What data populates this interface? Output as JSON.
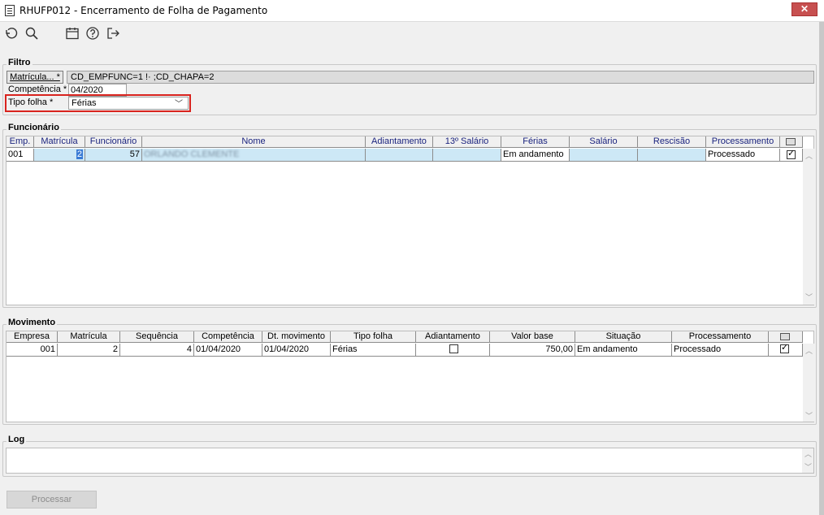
{
  "window": {
    "title": "RHUFP012 - Encerramento de Folha de Pagamento",
    "close_label": "✕"
  },
  "toolbar": {
    "icons": [
      "undo-icon",
      "search-icon",
      "calendar-icon",
      "help-icon",
      "exit-icon"
    ]
  },
  "filtro": {
    "legend": "Filtro",
    "matricula_button": "Matrícula... *",
    "matricula_value": "CD_EMPFUNC=1 !· ;CD_CHAPA=2",
    "competencia_label": "Competência *",
    "competencia_value": "04/2020",
    "tipo_folha_label": "Tipo folha *",
    "tipo_folha_value": "Férias"
  },
  "funcionario": {
    "legend": "Funcionário",
    "columns": [
      "Emp.",
      "Matrícula",
      "Funcionário",
      "Nome",
      "Adiantamento",
      "13º Salário",
      "Férias",
      "Salário",
      "Rescisão",
      "Processamento"
    ],
    "rows": [
      {
        "emp": "001",
        "matricula": "2",
        "funcionario": "57",
        "nome": "ORLANDO CLEMENTE",
        "adiantamento": "",
        "decimo": "",
        "ferias": "Em andamento",
        "salario": "",
        "rescisao": "",
        "processamento": "Processado",
        "checked": true
      }
    ]
  },
  "movimento": {
    "legend": "Movimento",
    "columns": [
      "Empresa",
      "Matrícula",
      "Sequência",
      "Competência",
      "Dt. movimento",
      "Tipo folha",
      "Adiantamento",
      "Valor base",
      "Situação",
      "Processamento"
    ],
    "rows": [
      {
        "empresa": "001",
        "matricula": "2",
        "sequencia": "4",
        "competencia": "01/04/2020",
        "dt_movimento": "01/04/2020",
        "tipo_folha": "Férias",
        "adiantamento": false,
        "valor_base": "750,00",
        "situacao": "Em andamento",
        "processamento": "Processado",
        "checked": true
      }
    ]
  },
  "log": {
    "legend": "Log",
    "text": ""
  },
  "footer": {
    "processar_label": "Processar"
  },
  "colors": {
    "highlight_border": "#d9231e",
    "selected_row": "#cde8f6",
    "header_text": "#1a237e"
  }
}
